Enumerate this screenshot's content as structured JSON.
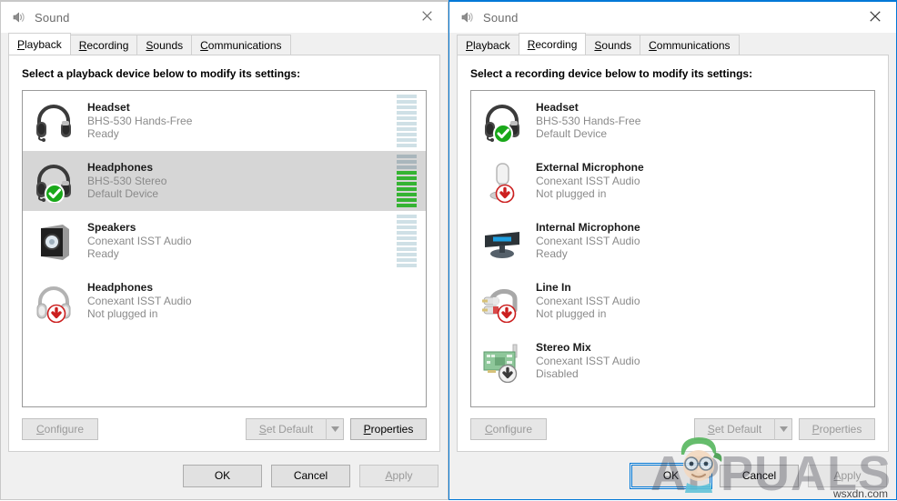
{
  "windows": [
    {
      "id": "playback-window",
      "title": "Sound",
      "active": false,
      "close_label": "✕",
      "tabs": [
        {
          "label": "Playback",
          "accel": "P",
          "rest": "layback",
          "active": true
        },
        {
          "label": "Recording",
          "accel": "R",
          "rest": "ecording",
          "active": false
        },
        {
          "label": "Sounds",
          "accel": "S",
          "rest": "ounds",
          "active": false
        },
        {
          "label": "Communications",
          "accel": "C",
          "rest": "ommunications",
          "active": false
        }
      ],
      "prompt": "Select a playback device below to modify its settings:",
      "devices": [
        {
          "name": "Headset",
          "desc": "BHS-530 Hands-Free",
          "status": "Ready",
          "icon": "headset-icon",
          "badge": "none",
          "selected": false,
          "meter": {
            "visible": true,
            "total": 10,
            "active": 0
          }
        },
        {
          "name": "Headphones",
          "desc": "BHS-530 Stereo",
          "status": "Default Device",
          "icon": "headset-icon",
          "badge": "check",
          "selected": true,
          "meter": {
            "visible": true,
            "total": 10,
            "active": 7
          }
        },
        {
          "name": "Speakers",
          "desc": "Conexant ISST Audio",
          "status": "Ready",
          "icon": "speaker-box-icon",
          "badge": "none",
          "selected": false,
          "meter": {
            "visible": true,
            "total": 10,
            "active": 0
          }
        },
        {
          "name": "Headphones",
          "desc": "Conexant ISST Audio",
          "status": "Not plugged in",
          "icon": "headphones-icon",
          "badge": "unplugged",
          "selected": false,
          "meter": {
            "visible": false,
            "total": 10,
            "active": 0
          }
        }
      ],
      "panel_buttons": {
        "configure": {
          "accel": "C",
          "rest": "onfigure",
          "enabled": false
        },
        "set_default": {
          "accel": "S",
          "rest": "et Default",
          "enabled": false
        },
        "properties": {
          "accel": "P",
          "rest": "roperties",
          "enabled": true
        }
      },
      "footer_buttons": {
        "ok": {
          "label": "OK",
          "enabled": true,
          "focused": false
        },
        "cancel": {
          "label": "Cancel",
          "enabled": true,
          "focused": false
        },
        "apply": {
          "accel": "A",
          "rest": "pply",
          "enabled": false,
          "focused": false
        }
      }
    },
    {
      "id": "recording-window",
      "title": "Sound",
      "active": true,
      "close_label": "✕",
      "tabs": [
        {
          "label": "Playback",
          "accel": "P",
          "rest": "layback",
          "active": false
        },
        {
          "label": "Recording",
          "accel": "R",
          "rest": "ecording",
          "active": true
        },
        {
          "label": "Sounds",
          "accel": "S",
          "rest": "ounds",
          "active": false
        },
        {
          "label": "Communications",
          "accel": "C",
          "rest": "ommunications",
          "active": false
        }
      ],
      "prompt": "Select a recording device below to modify its settings:",
      "devices": [
        {
          "name": "Headset",
          "desc": "BHS-530 Hands-Free",
          "status": "Default Device",
          "icon": "headset-icon",
          "badge": "check",
          "selected": false,
          "meter": {
            "visible": false,
            "total": 10,
            "active": 0
          }
        },
        {
          "name": "External Microphone",
          "desc": "Conexant ISST Audio",
          "status": "Not plugged in",
          "icon": "microphone-icon",
          "badge": "unplugged",
          "selected": false,
          "meter": {
            "visible": false,
            "total": 10,
            "active": 0
          }
        },
        {
          "name": "Internal Microphone",
          "desc": "Conexant ISST Audio",
          "status": "Ready",
          "icon": "internal-mic-icon",
          "badge": "none",
          "selected": false,
          "meter": {
            "visible": false,
            "total": 10,
            "active": 0
          }
        },
        {
          "name": "Line In",
          "desc": "Conexant ISST Audio",
          "status": "Not plugged in",
          "icon": "line-in-icon",
          "badge": "unplugged",
          "selected": false,
          "meter": {
            "visible": false,
            "total": 10,
            "active": 0
          }
        },
        {
          "name": "Stereo Mix",
          "desc": "Conexant ISST Audio",
          "status": "Disabled",
          "icon": "sound-card-icon",
          "badge": "disabled",
          "selected": false,
          "meter": {
            "visible": false,
            "total": 10,
            "active": 0
          }
        }
      ],
      "panel_buttons": {
        "configure": {
          "accel": "C",
          "rest": "onfigure",
          "enabled": false
        },
        "set_default": {
          "accel": "S",
          "rest": "et Default",
          "enabled": false
        },
        "properties": {
          "accel": "P",
          "rest": "roperties",
          "enabled": false
        }
      },
      "footer_buttons": {
        "ok": {
          "label": "OK",
          "enabled": true,
          "focused": true
        },
        "cancel": {
          "label": "Cancel",
          "enabled": true,
          "focused": false
        },
        "apply": {
          "accel": "A",
          "rest": "pply",
          "enabled": false,
          "focused": false
        }
      }
    }
  ],
  "watermark": {
    "brand": "APPUALS",
    "sub": "wsxdn.com"
  },
  "colors": {
    "accent_blue": "#0078d7",
    "meter_green": "#35b333",
    "meter_idle": "#cfe0e6",
    "badge_red": "#cc1f1f",
    "badge_green": "#19a819",
    "selected_row": "#d6d6d6"
  }
}
